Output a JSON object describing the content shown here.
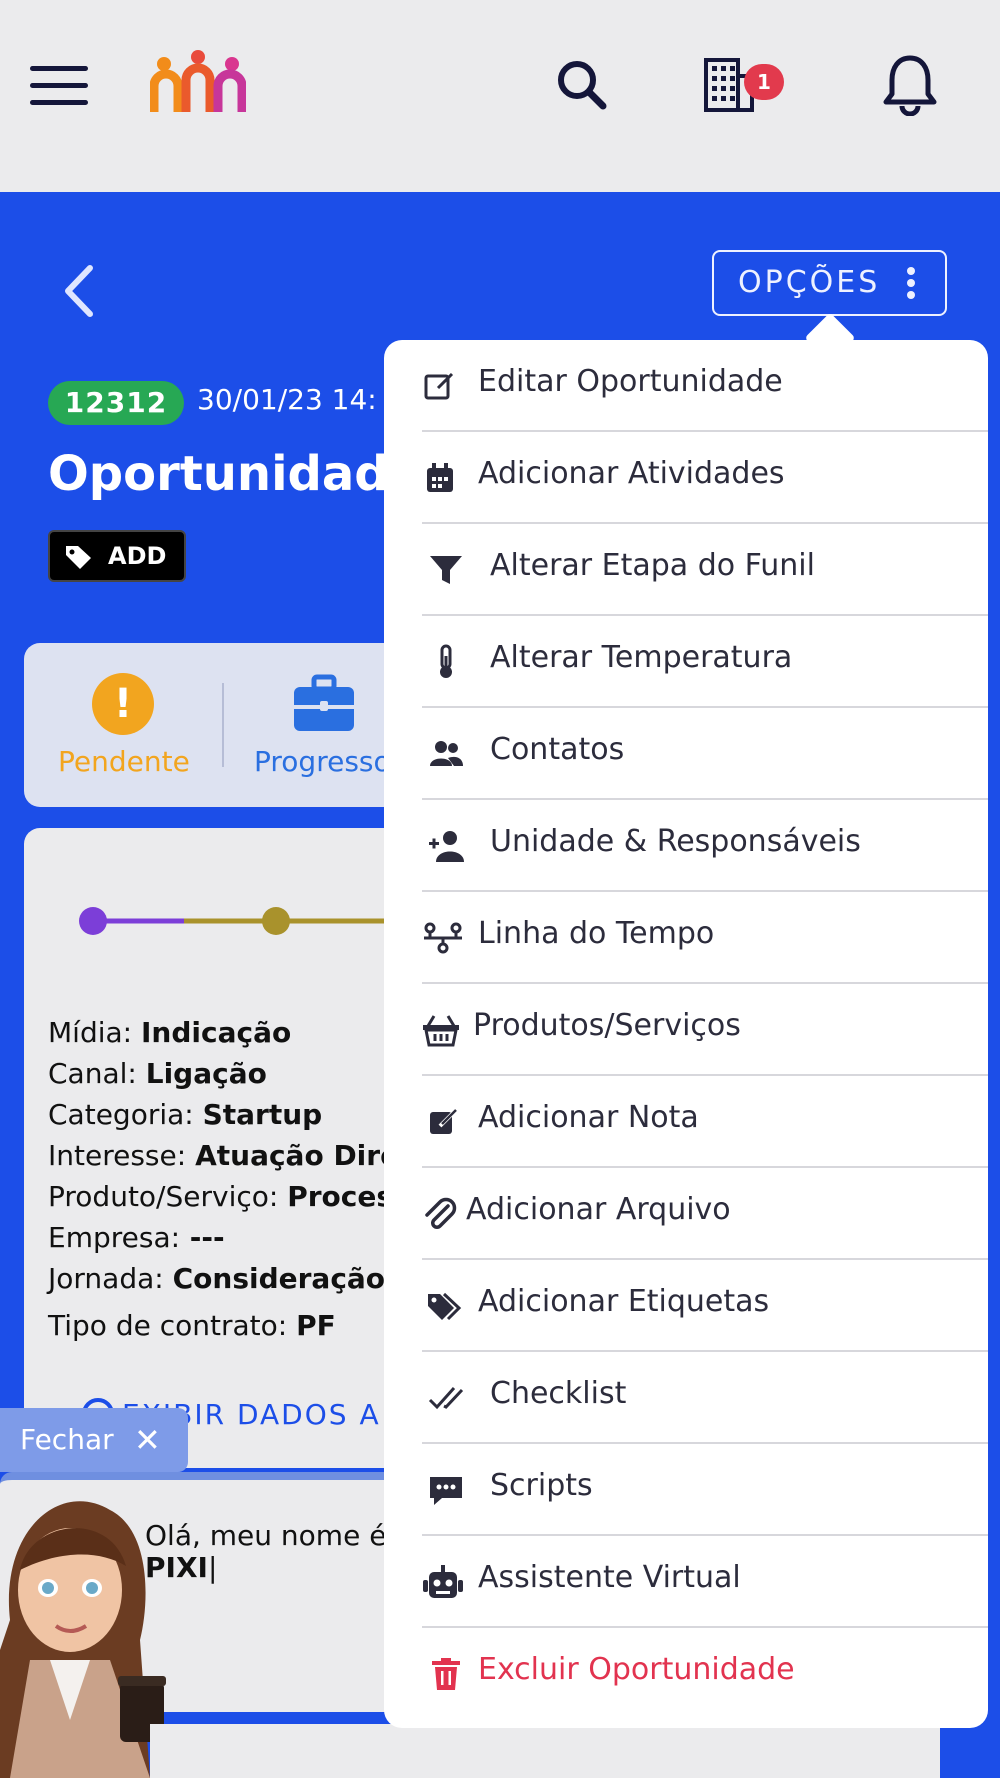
{
  "header": {
    "icons": [
      "menu-icon",
      "app-logo",
      "search-icon",
      "building-icon",
      "bell-icon"
    ],
    "notification_count": "1"
  },
  "opportunity": {
    "options_label": "OPÇÕES",
    "id": "12312",
    "date": "30/01/23 14:",
    "title": "Oportunidade",
    "tag_label": "ADD"
  },
  "status": {
    "items": [
      {
        "label": "Pendente",
        "color": "#f2a51f",
        "icon": "exclamation-icon"
      },
      {
        "label": "Progresso",
        "color": "#2a6fe0",
        "icon": "briefcase-icon"
      }
    ]
  },
  "details": {
    "rows": [
      {
        "label": "Mídia:",
        "value": "Indicação"
      },
      {
        "label": "Canal:",
        "value": "Ligação"
      },
      {
        "label": "Categoria:",
        "value": "Startup"
      },
      {
        "label": "Interesse:",
        "value": "Atuação Dire"
      },
      {
        "label": "Produto/Serviço: ",
        "value": " Proces"
      },
      {
        "label": "Empresa:",
        "value": " ---"
      },
      {
        "label": "Jornada:",
        "value": "Consideração"
      },
      {
        "label": "Tipo de contrato:",
        "value": "PF"
      }
    ],
    "show_more": "EXIBIR DADOS A"
  },
  "assistant": {
    "close_label": "Fechar",
    "greeting": "Olá, meu nome é",
    "name": "PIXI"
  },
  "menu": {
    "items": [
      {
        "label": "Editar Oportunidade",
        "icon": "edit-icon"
      },
      {
        "label": "Adicionar Atividades",
        "icon": "calendar-icon"
      },
      {
        "label": "Alterar Etapa do Funil",
        "icon": "funnel-icon"
      },
      {
        "label": "Alterar Temperatura",
        "icon": "thermometer-icon"
      },
      {
        "label": "Contatos",
        "icon": "users-icon"
      },
      {
        "label": "Unidade & Responsáveis",
        "icon": "user-plus-icon"
      },
      {
        "label": "Linha do Tempo",
        "icon": "timeline-icon"
      },
      {
        "label": "Produtos/Serviços",
        "icon": "basket-icon"
      },
      {
        "label": "Adicionar Nota",
        "icon": "note-icon"
      },
      {
        "label": "Adicionar Arquivo",
        "icon": "paperclip-icon"
      },
      {
        "label": "Adicionar Etiquetas",
        "icon": "tags-icon"
      },
      {
        "label": "Checklist",
        "icon": "double-check-icon"
      },
      {
        "label": "Scripts",
        "icon": "comment-dots-icon"
      },
      {
        "label": "Assistente Virtual",
        "icon": "robot-icon"
      },
      {
        "label": "Excluir Oportunidade",
        "icon": "trash-icon",
        "danger": true
      }
    ]
  },
  "colors": {
    "brand_blue": "#1c4ee8",
    "danger": "#e2334f",
    "success": "#27a854",
    "warning": "#f2a51f"
  }
}
